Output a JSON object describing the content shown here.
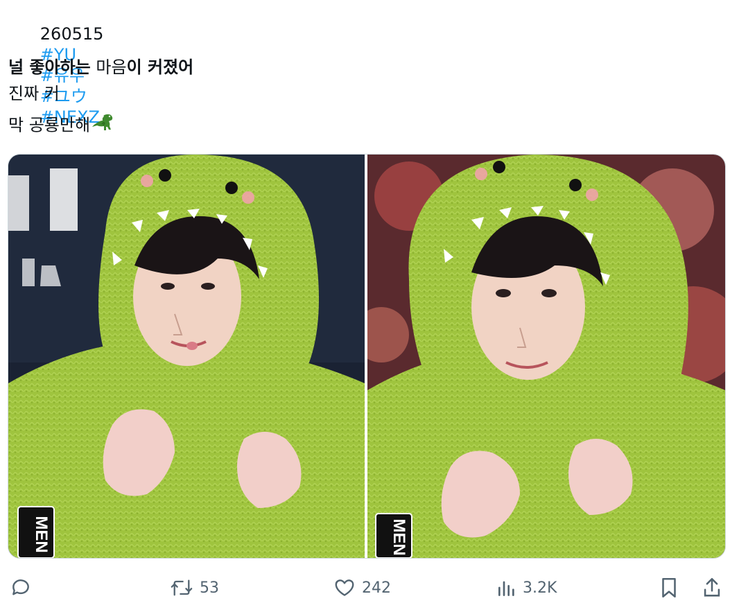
{
  "post": {
    "date_prefix": "260515",
    "hashtags": [
      "#YU",
      "#유우",
      "#ユウ",
      "#NEXZ"
    ],
    "line2_a": "널 좋아하는",
    "line2_b": " 마음",
    "line2_c": "이 커졌어",
    "line3": "진짜 커",
    "line4": "막 공룡만해",
    "emoji": "t-rex"
  },
  "media": {
    "count": 2,
    "left_sign": "MEN",
    "right_sign": "MEN"
  },
  "actions": {
    "reply_count": "",
    "retweet_count": "53",
    "like_count": "242",
    "view_count": "3.2K"
  },
  "colors": {
    "hashtag": "#1d9bf0",
    "text": "#0f1419",
    "muted": "#536471",
    "costume_green": "#9bbd3a"
  }
}
